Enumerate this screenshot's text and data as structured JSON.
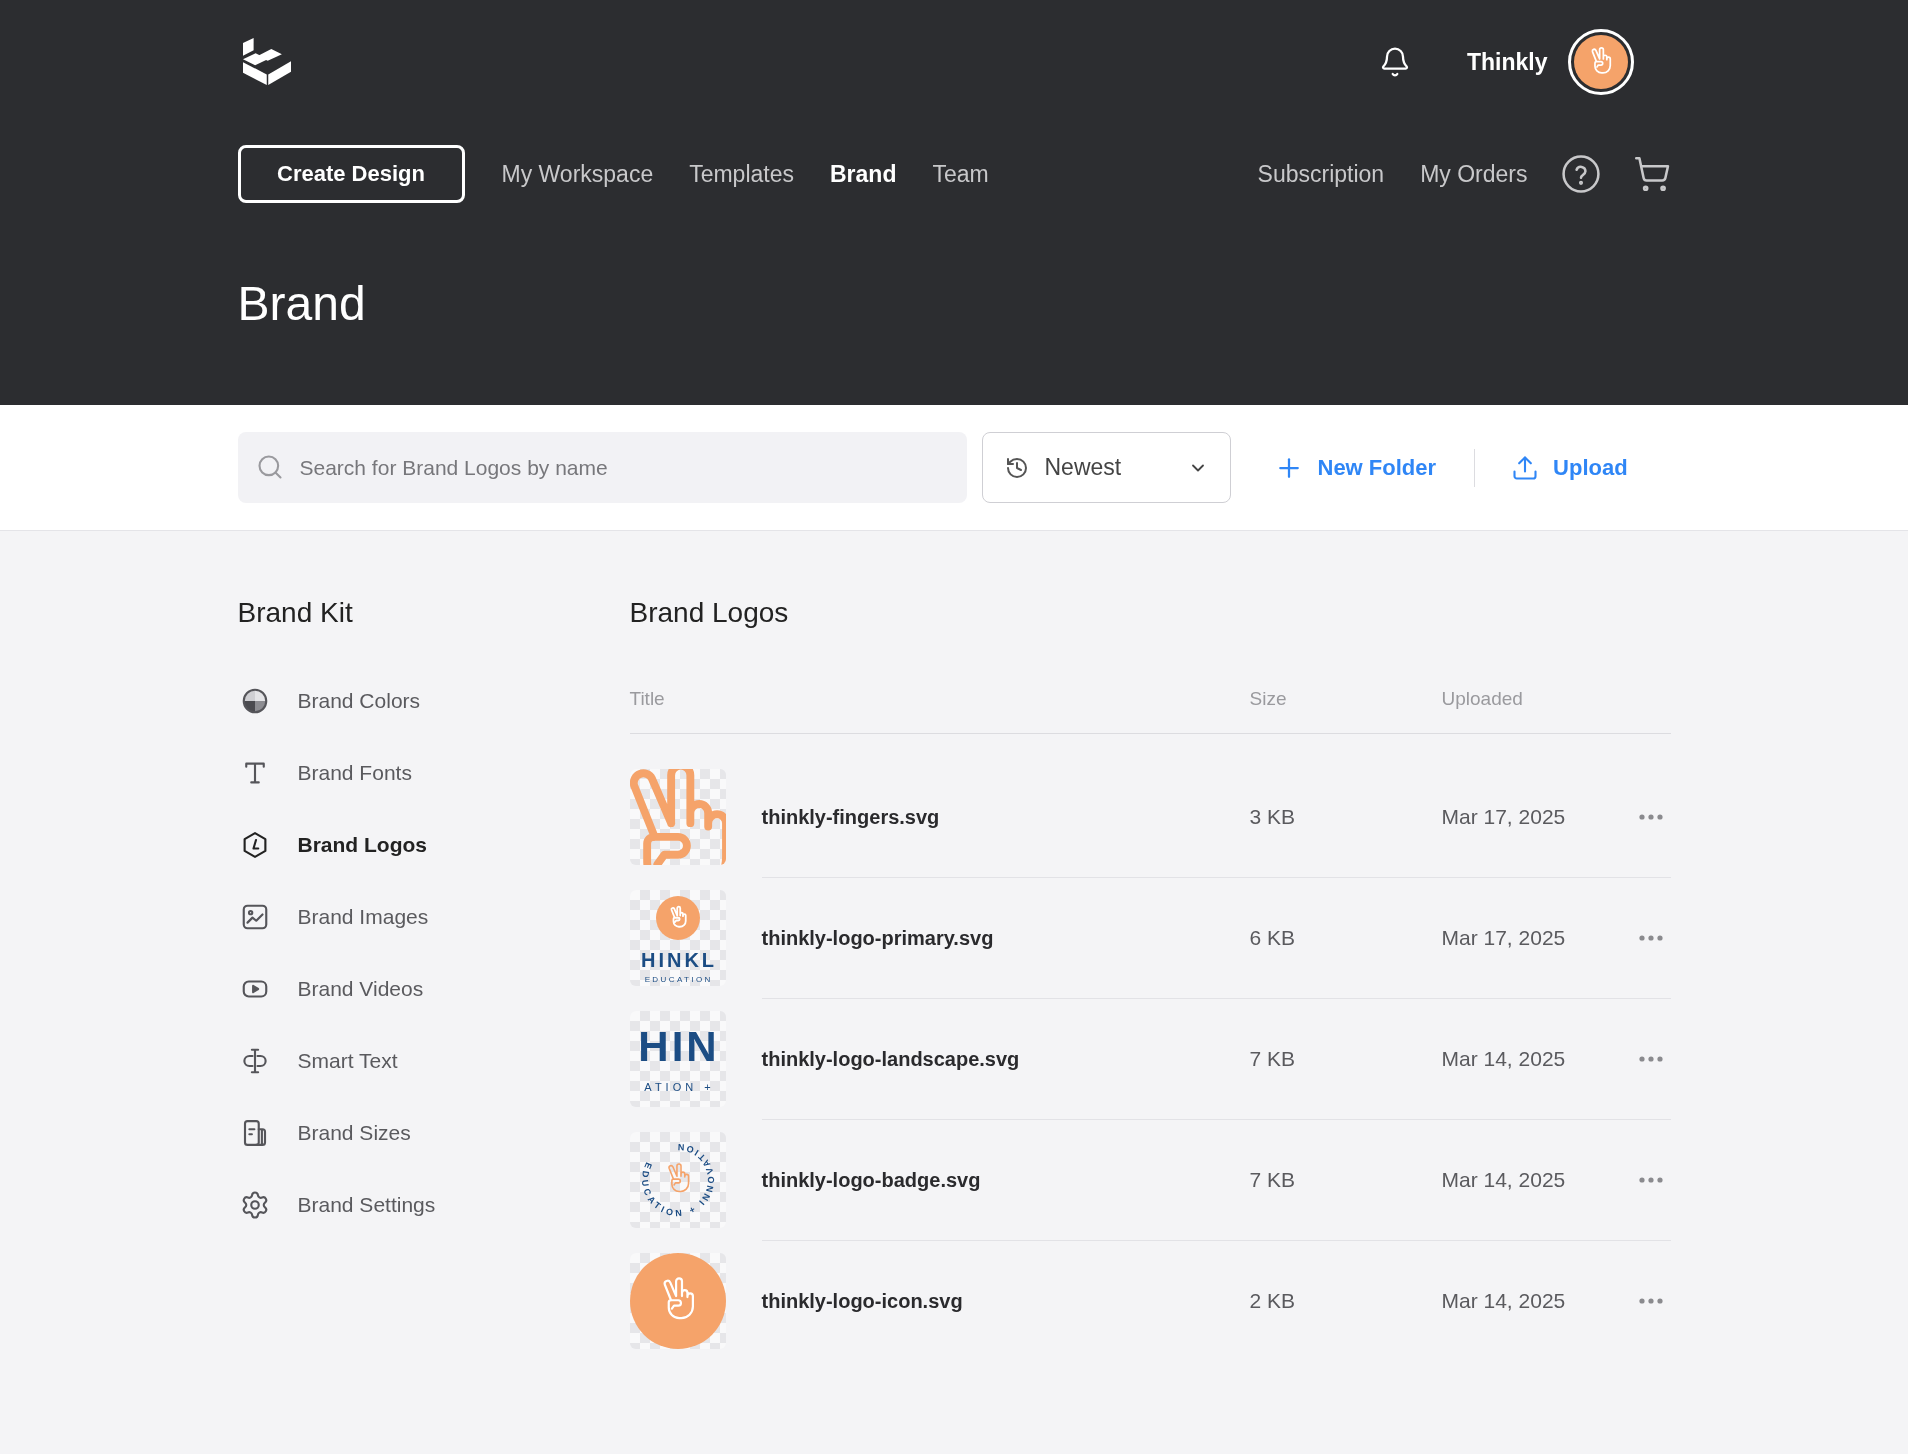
{
  "header": {
    "user_name": "Thinkly"
  },
  "nav": {
    "create_button": "Create Design",
    "links": [
      {
        "label": "My Workspace",
        "selected": false
      },
      {
        "label": "Templates",
        "selected": false
      },
      {
        "label": "Brand",
        "selected": true
      },
      {
        "label": "Team",
        "selected": false
      }
    ],
    "account_links": [
      {
        "label": "Subscription",
        "selected": false
      },
      {
        "label": "My Orders",
        "selected": false
      }
    ]
  },
  "page_title": "Brand",
  "toolbar": {
    "search": {
      "placeholder": "Search for Brand Logos by name"
    },
    "sort": {
      "value": "Newest"
    },
    "actions": [
      {
        "kind": "new-folder",
        "label": "New Folder"
      },
      {
        "kind": "upload",
        "label": "Upload"
      }
    ]
  },
  "sidebar": {
    "title": "Brand Kit",
    "items": [
      {
        "kind": "colors",
        "label": "Brand Colors",
        "selected": false
      },
      {
        "kind": "fonts",
        "label": "Brand Fonts",
        "selected": false
      },
      {
        "kind": "logos",
        "label": "Brand Logos",
        "selected": true
      },
      {
        "kind": "images",
        "label": "Brand Images",
        "selected": false
      },
      {
        "kind": "videos",
        "label": "Brand Videos",
        "selected": false
      },
      {
        "kind": "smart-text",
        "label": "Smart Text",
        "selected": false
      },
      {
        "kind": "sizes",
        "label": "Brand Sizes",
        "selected": false
      },
      {
        "kind": "settings",
        "label": "Brand Settings",
        "selected": false
      }
    ]
  },
  "logos": {
    "title": "Brand Logos",
    "columns": [
      "Title",
      "Size",
      "Uploaded"
    ],
    "rows": [
      {
        "name": "thinkly-fingers.svg",
        "size": "3 KB",
        "uploaded": "Mar 17, 2025",
        "preview": {
          "kind": "hand-outline"
        }
      },
      {
        "name": "thinkly-logo-primary.svg",
        "size": "6 KB",
        "uploaded": "Mar 17, 2025",
        "preview": {
          "kind": "stacked",
          "wordmark": "HINKL",
          "tagline": "EDUCATION"
        }
      },
      {
        "name": "thinkly-logo-landscape.svg",
        "size": "7 KB",
        "uploaded": "Mar 14, 2025",
        "preview": {
          "kind": "wordmark",
          "wordmark": "HIN",
          "tagline": "ATION +"
        }
      },
      {
        "name": "thinkly-logo-badge.svg",
        "size": "7 KB",
        "uploaded": "Mar 14, 2025",
        "preview": {
          "kind": "badge",
          "ring_text": "EDUCATION + INNOVATION"
        }
      },
      {
        "name": "thinkly-logo-icon.svg",
        "size": "2 KB",
        "uploaded": "Mar 14, 2025",
        "preview": {
          "kind": "emblem"
        }
      }
    ]
  }
}
